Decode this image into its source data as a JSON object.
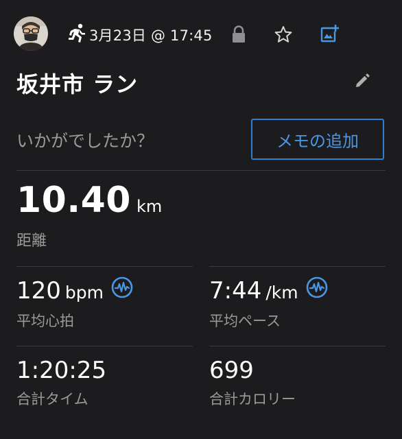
{
  "header": {
    "date": "3月23日 @ 17:45",
    "avatar_icon": "user-avatar",
    "activity_icon": "running-person-icon",
    "icons": [
      "lock-icon",
      "star-icon",
      "add-photo-icon"
    ]
  },
  "activity": {
    "title": "坂井市 ラン",
    "edit_icon": "pencil-icon"
  },
  "memo": {
    "prompt": "いかがでしたか？",
    "button_label": "メモの追加"
  },
  "distance": {
    "value": "10.40",
    "unit": "km",
    "label": "距離"
  },
  "stats": {
    "heart_rate": {
      "value": "120",
      "unit": "bpm",
      "label": "平均心拍",
      "icon": "pulse-chart-icon"
    },
    "pace": {
      "value": "7:44",
      "unit": "/km",
      "label": "平均ペース",
      "icon": "pulse-chart-icon"
    },
    "time": {
      "value": "1:20:25",
      "label": "合計タイム"
    },
    "calories": {
      "value": "699",
      "label": "合計カロリー"
    }
  },
  "colors": {
    "background": "#1c1c1e",
    "accent": "#2f7fd0",
    "divider": "#3a3a3c",
    "secondary_text": "#9a9a9a"
  }
}
